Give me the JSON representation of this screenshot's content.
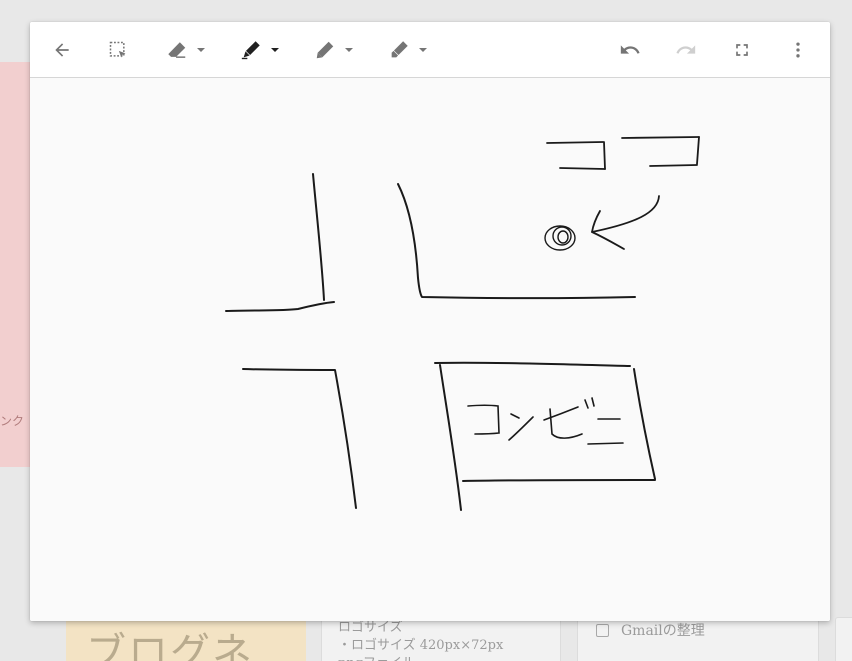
{
  "background": {
    "side_text": "ンク",
    "card_title": "ブログネ",
    "note_lines": [
      "ロゴサイズ",
      "・ロゴサイズ 420px×72px",
      "pngファイル"
    ],
    "checklist_item": "Gmailの整理"
  },
  "toolbar": {
    "icons": [
      "back-arrow-icon",
      "select-icon",
      "eraser-icon",
      "pen-icon",
      "marker-icon",
      "highlighter-icon",
      "undo-icon",
      "redo-icon",
      "fullscreen-icon",
      "more-vert-icon"
    ],
    "colors": {
      "icon": "#757575",
      "icon_disabled": "#cfcfcf",
      "active_pen": "#202020"
    }
  },
  "drawing": {
    "handwritten_labels": [
      "ココ",
      "コンビニ"
    ]
  }
}
